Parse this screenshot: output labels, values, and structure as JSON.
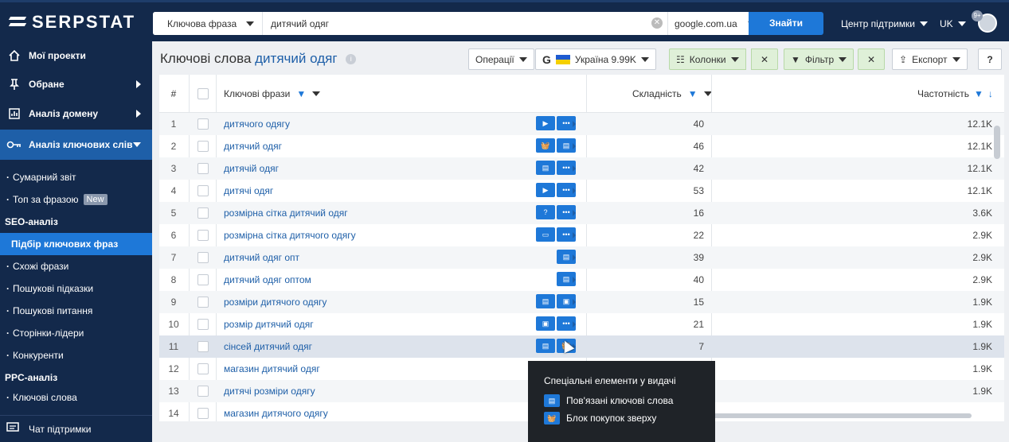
{
  "brand": "SERPSTAT",
  "search": {
    "type_label": "Ключова фраза",
    "query": "дитячий одяг",
    "engine": "google.com.ua",
    "find_label": "Знайти"
  },
  "topnav": {
    "support": "Центр підтримки",
    "lang": "UK",
    "notif_count": "9+"
  },
  "sidebar": {
    "items": [
      {
        "label": "Мої проекти",
        "icon": "home-icon"
      },
      {
        "label": "Обране",
        "icon": "pin-icon"
      },
      {
        "label": "Аналіз домену",
        "icon": "chart-icon"
      },
      {
        "label": "Аналіз ключових слів",
        "icon": "key-icon"
      }
    ],
    "sub": [
      {
        "label": "Сумарний звіт"
      },
      {
        "label": "Топ за фразою",
        "badge": "New"
      },
      {
        "label": "SEO-аналіз"
      },
      {
        "label": "Підбір ключових фраз"
      },
      {
        "label": "Схожі фрази"
      },
      {
        "label": "Пошукові підказки"
      },
      {
        "label": "Пошукові питання"
      },
      {
        "label": "Сторінки-лідери"
      },
      {
        "label": "Конкуренти"
      },
      {
        "label": "PPC-аналіз"
      },
      {
        "label": "Ключові слова"
      }
    ],
    "chat": "Чат підтримки"
  },
  "header": {
    "title": "Ключові слова",
    "keyword": "дитячий одяг",
    "operations": "Операції",
    "region": "Україна 9.99K",
    "columns": "Колонки",
    "filter": "Фільтр",
    "export": "Експорт"
  },
  "table": {
    "columns": [
      "#",
      "Ключові фрази",
      "Складність",
      "Частотність"
    ],
    "rows": [
      {
        "n": "1",
        "kw": "дитячого одягу",
        "diff": "40",
        "freq": "12.1K"
      },
      {
        "n": "2",
        "kw": "дитячий одяг",
        "diff": "46",
        "freq": "12.1K"
      },
      {
        "n": "3",
        "kw": "дитячій одяг",
        "diff": "42",
        "freq": "12.1K"
      },
      {
        "n": "4",
        "kw": "дитячі одяг",
        "diff": "53",
        "freq": "12.1K"
      },
      {
        "n": "5",
        "kw": "розмірна сітка дитячий одяг",
        "diff": "16",
        "freq": "3.6K"
      },
      {
        "n": "6",
        "kw": "розмірна сітка дитячого одягу",
        "diff": "22",
        "freq": "2.9K"
      },
      {
        "n": "7",
        "kw": "дитячий одяг опт",
        "diff": "39",
        "freq": "2.9K"
      },
      {
        "n": "8",
        "kw": "дитячий одяг оптом",
        "diff": "40",
        "freq": "2.9K"
      },
      {
        "n": "9",
        "kw": "розміри дитячого одягу",
        "diff": "15",
        "freq": "1.9K"
      },
      {
        "n": "10",
        "kw": "розмір дитячий одяг",
        "diff": "21",
        "freq": "1.9K"
      },
      {
        "n": "11",
        "kw": "сінсей дитячий одяг",
        "diff": "7",
        "freq": "1.9K"
      },
      {
        "n": "12",
        "kw": "магазин дитячий одяг",
        "diff": "",
        "freq": "1.9K"
      },
      {
        "n": "13",
        "kw": "дитячі розміри одягу",
        "diff": "",
        "freq": "1.9K"
      },
      {
        "n": "14",
        "kw": "магазин дитячого одягу",
        "diff": "",
        "freq": ""
      }
    ]
  },
  "tooltip": {
    "title": "Спеціальні елементи у видачі",
    "items": [
      "Пов'язані ключові слова",
      "Блок покупок зверху"
    ]
  },
  "colors": {
    "navy": "#13294b",
    "accent": "#1e78d8",
    "link": "#1e5fa8"
  }
}
